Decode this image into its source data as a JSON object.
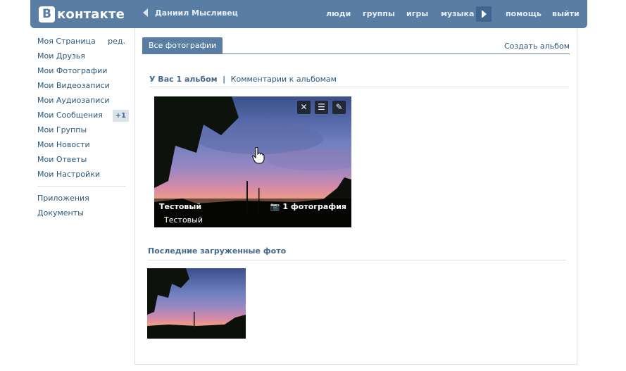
{
  "header": {
    "logo_letter": "В",
    "logo_text": "контакте",
    "user_name": "Даниил Мысливец",
    "nav": [
      "люди",
      "группы",
      "игры",
      "музыка",
      "помощь",
      "выйти"
    ],
    "color": "#597da3"
  },
  "sidebar": {
    "items": [
      {
        "label": "Моя Страница",
        "extra": "ред."
      },
      {
        "label": "Мои Друзья"
      },
      {
        "label": "Мои Фотографии"
      },
      {
        "label": "Мои Видеозаписи"
      },
      {
        "label": "Мои Аудиозаписи"
      },
      {
        "label": "Мои Сообщения",
        "badge": "+1"
      },
      {
        "label": "Мои Группы"
      },
      {
        "label": "Мои Новости"
      },
      {
        "label": "Мои Ответы"
      },
      {
        "label": "Мои Настройки"
      }
    ],
    "extra_items": [
      "Приложения",
      "Документы"
    ]
  },
  "content": {
    "tab": "Все фотографии",
    "create_album": "Создать альбом",
    "albums_count": "У Вас 1 альбом",
    "albums_separator": "|",
    "albums_comments": "Комментарии к альбомам",
    "album": {
      "title": "Тестовый",
      "photo_count": "1 фотография",
      "description": "Тестовый",
      "tools": [
        "close-icon",
        "menu-icon",
        "edit-icon"
      ]
    },
    "recent_title": "Последние загруженные фото"
  }
}
